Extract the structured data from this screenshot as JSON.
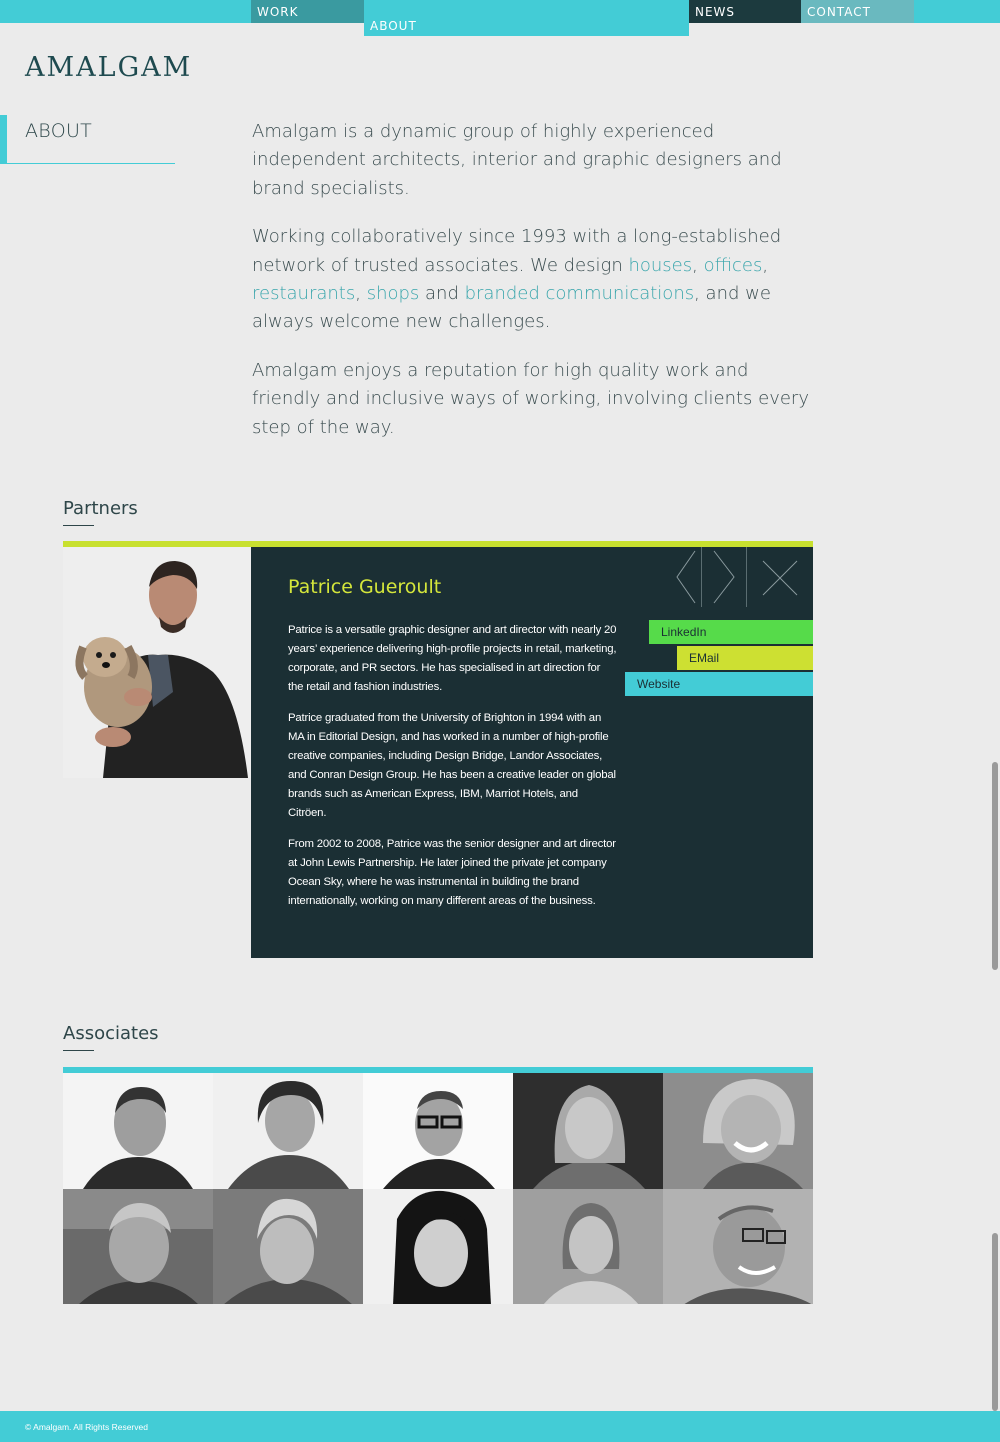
{
  "nav": {
    "work": "WORK",
    "about": "ABOUT",
    "news": "NEWS",
    "contact": "CONTACT"
  },
  "logo": "AMALGAM",
  "side_heading": "ABOUT",
  "intro": {
    "p1": "Amalgam is a dynamic group of highly experienced independent architects, interior and graphic designers and brand specialists.",
    "p2_start": "Working collaboratively since 1993 with a long-established network of trusted associates. We design ",
    "link_houses": "houses",
    "link_offices": "offices",
    "link_restaurants": "restaurants",
    "link_shops": "shops",
    "link_branded": "branded communications",
    "p2_end": ", and we always welcome new challenges.",
    "p3": "Amalgam enjoys a reputation for high quality work and friendly and inclusive ways of working, involving clients every step of the way."
  },
  "partners": {
    "title": "Partners",
    "name": "Patrice Gueroult",
    "bio": [
      "Patrice is a versatile graphic designer and art director with nearly 20 years’ experience delivering high-profile projects in retail, marketing, corporate, and PR sectors. He has specialised in art direction for the retail and fashion industries.",
      "Patrice graduated from the University of Brighton in 1994 with an MA in Editorial Design, and has worked in a number of high-profile creative companies, including Design Bridge, Landor Associates, and Conran Design Group. He has been a creative leader on global brands such as American Express, IBM, Marriot Hotels, and Citröen.",
      "From 2002 to 2008, Patrice was the senior designer and art director at John Lewis Partnership. He later joined the private jet company Ocean Sky, where he was instrumental in building the brand internationally, working on many different areas of the business."
    ],
    "links": {
      "linkedin": "LinkedIn",
      "email": "EMail",
      "website": "Website"
    }
  },
  "associates": {
    "title": "Associates"
  },
  "footer": "© Amalgam. All Rights Reserved",
  "colors": {
    "accent": "#43ccd6",
    "dark_panel": "#1b2f34",
    "lime": "#c8e02f",
    "green": "#56db4a"
  }
}
